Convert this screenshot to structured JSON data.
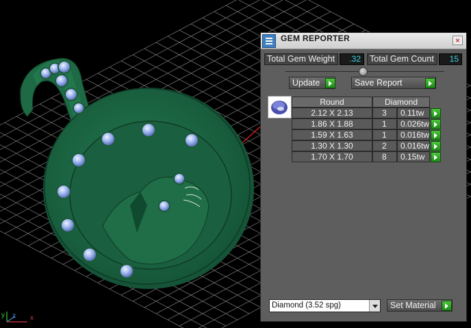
{
  "viewport": {
    "axis_labels": {
      "y": "y",
      "z": "z",
      "x": "x"
    }
  },
  "panel": {
    "title": "GEM REPORTER",
    "close_glyph": "×",
    "total_weight_label": "Total Gem Weight",
    "total_weight_value": ".32",
    "total_count_label": "Total Gem Count",
    "total_count_value": "15",
    "update_label": "Update",
    "save_report_label": "Save Report",
    "table": {
      "headers": [
        "Round",
        "Diamond"
      ],
      "rows": [
        {
          "size": "2.12 X 2.13",
          "count": "3",
          "weight": "0.11tw"
        },
        {
          "size": "1.86 X 1.88",
          "count": "1",
          "weight": "0.026tw"
        },
        {
          "size": "1.59 X 1.63",
          "count": "1",
          "weight": "0.016tw"
        },
        {
          "size": "1.30 X 1.30",
          "count": "2",
          "weight": "0.016tw"
        },
        {
          "size": "1.70 X 1.70",
          "count": "8",
          "weight": "0.15tw"
        }
      ]
    },
    "material_select": {
      "value": "Diamond     (3.52 spg)"
    },
    "set_material_label": "Set Material"
  },
  "colors": {
    "pendant": "#1f6e48",
    "grid": "#7a7a7a",
    "gem": "#9ab4f0",
    "panel_bg": "#5e5e5e",
    "accent_value": "#3fd4e8",
    "arrow_green": "#2faa23"
  }
}
